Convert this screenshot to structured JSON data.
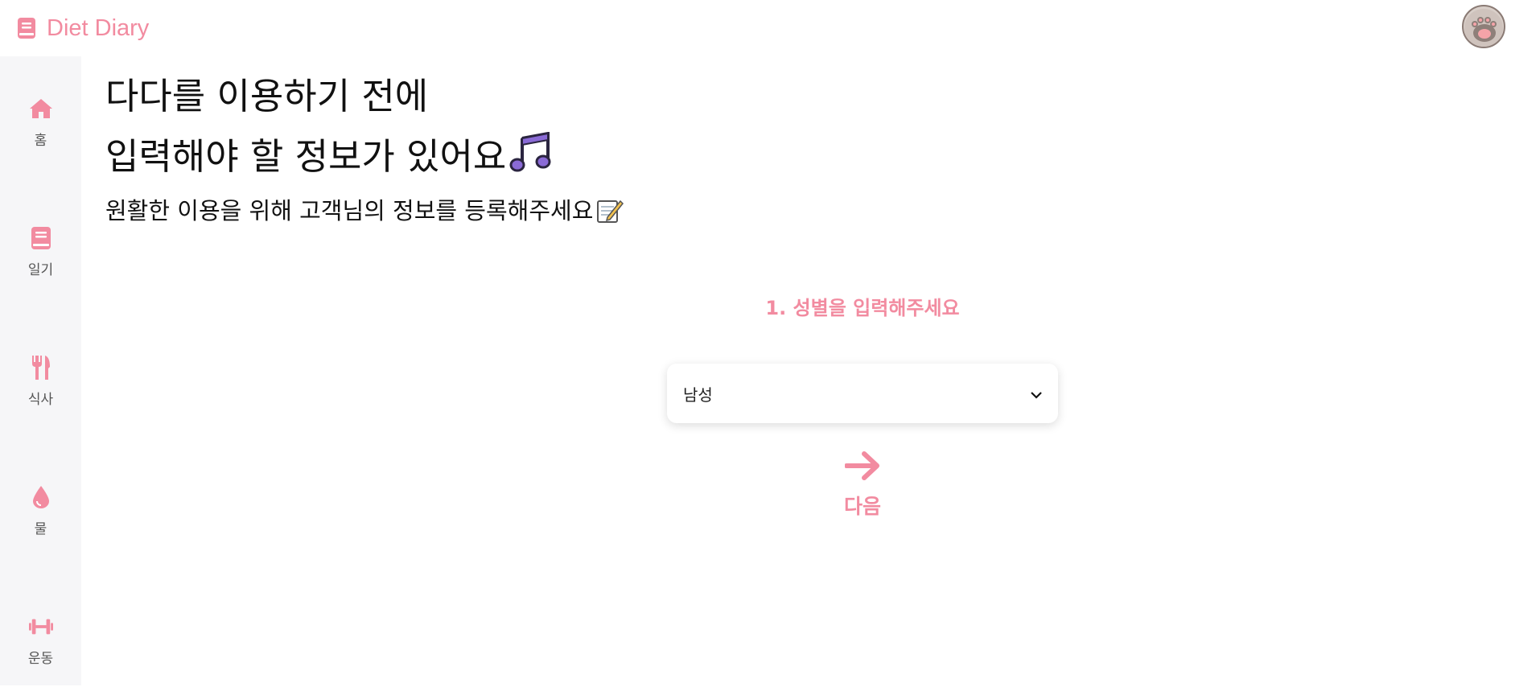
{
  "app": {
    "title": "Diet Diary",
    "accent_color": "#f28ba0"
  },
  "header": {
    "avatar_icon": "paw-avatar"
  },
  "sidebar": {
    "items": [
      {
        "label": "홈",
        "icon": "home-icon"
      },
      {
        "label": "일기",
        "icon": "book-icon"
      },
      {
        "label": "식사",
        "icon": "utensils-icon"
      },
      {
        "label": "물",
        "icon": "water-drop-icon"
      },
      {
        "label": "운동",
        "icon": "dumbbell-icon"
      }
    ]
  },
  "intro": {
    "line1": "다다를 이용하기 전에",
    "line2": "입력해야 할 정보가 있어요",
    "line2_emoji": "music-notes-emoji",
    "subtitle": "원활한 이용을 위해 고객님의 정보를 등록해주세요",
    "subtitle_emoji": "memo-emoji"
  },
  "form": {
    "step_title": "1. 성별을 입력해주세요",
    "gender_select": {
      "value": "남성"
    },
    "next_label": "다음"
  }
}
